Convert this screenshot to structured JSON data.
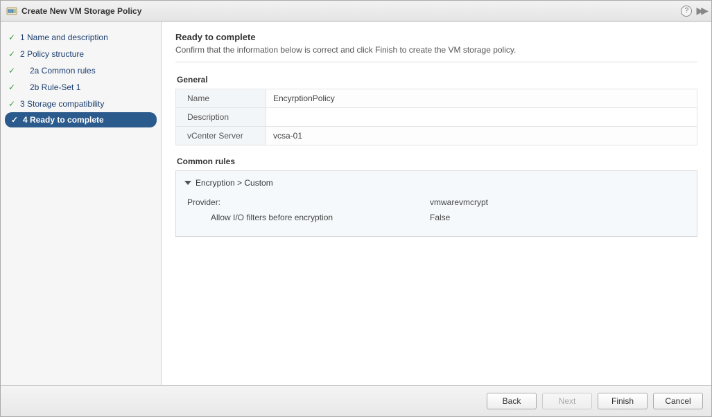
{
  "window": {
    "title": "Create New VM Storage Policy"
  },
  "steps": [
    {
      "label": "1 Name and description",
      "done": true,
      "active": false,
      "sub": false
    },
    {
      "label": "2 Policy structure",
      "done": true,
      "active": false,
      "sub": false
    },
    {
      "label": "2a Common rules",
      "done": true,
      "active": false,
      "sub": true
    },
    {
      "label": "2b Rule-Set 1",
      "done": true,
      "active": false,
      "sub": true
    },
    {
      "label": "3 Storage compatibility",
      "done": true,
      "active": false,
      "sub": false
    },
    {
      "label": "4 Ready to complete",
      "done": true,
      "active": true,
      "sub": false
    }
  ],
  "page": {
    "heading": "Ready to complete",
    "subtitle": "Confirm that the information below is correct and click Finish to create the VM storage policy."
  },
  "general": {
    "title": "General",
    "rows": [
      {
        "key": "Name",
        "value": "EncyrptionPolicy"
      },
      {
        "key": "Description",
        "value": ""
      },
      {
        "key": "vCenter Server",
        "value": "vcsa-01"
      }
    ]
  },
  "common_rules": {
    "title": "Common rules",
    "group": "Encryption > Custom",
    "provider_label": "Provider:",
    "provider_value": "vmwarevmcrypt",
    "setting_label": "Allow I/O filters before encryption",
    "setting_value": "False"
  },
  "buttons": {
    "back": "Back",
    "next": "Next",
    "finish": "Finish",
    "cancel": "Cancel"
  }
}
